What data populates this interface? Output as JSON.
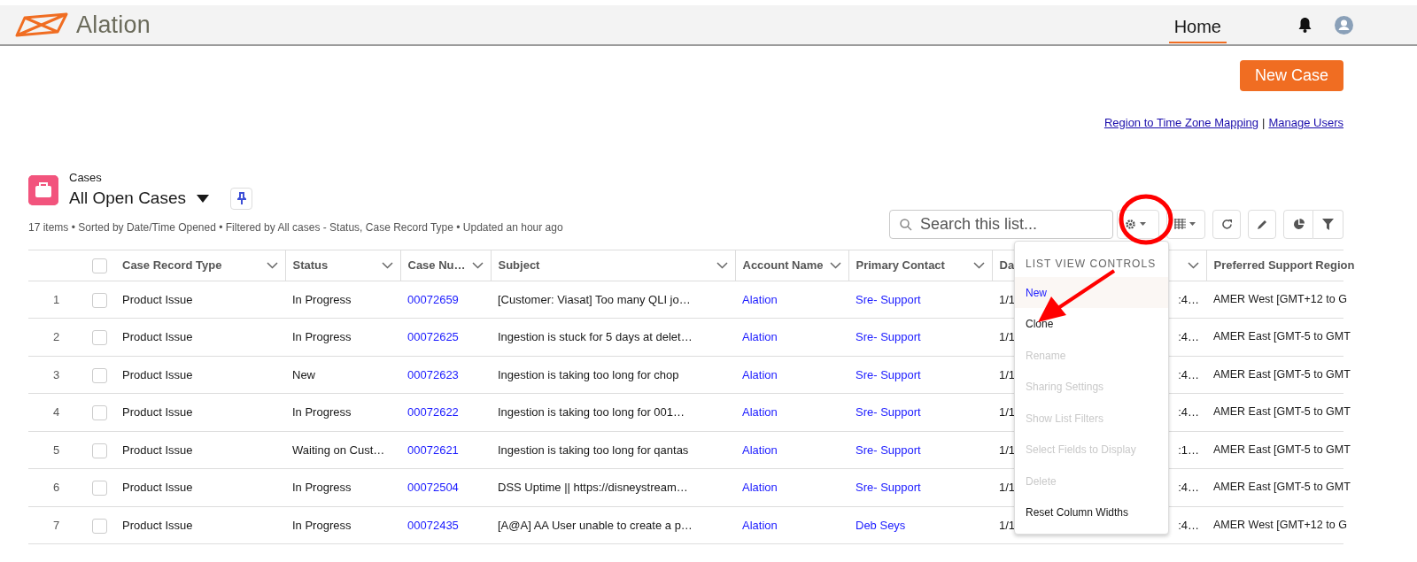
{
  "nav": {
    "logo_text": "Alation",
    "tabs": [
      {
        "label": "Home",
        "selected": true
      }
    ]
  },
  "new_case_button": "New Case",
  "links": [
    {
      "text": "Region to Time Zone Mapping"
    },
    {
      "text": "Manage Users"
    }
  ],
  "link_separator": "|",
  "list_header": {
    "object": "Cases",
    "title": "All Open Cases",
    "pinned": true
  },
  "summary": "17 items • Sorted by Date/Time Opened • Filtered by All cases - Status, Case Record Type • Updated an hour ago",
  "search": {
    "placeholder": "Search this list..."
  },
  "table": {
    "select_all_checked": false,
    "columns": [
      {
        "label": "Case Record Type",
        "sortable": true
      },
      {
        "label": "Status",
        "sortable": true
      },
      {
        "label": "Case Nu…",
        "sortable": true
      },
      {
        "label": "Subject",
        "sortable": true
      },
      {
        "label": "Account Name",
        "sortable": true
      },
      {
        "label": "Primary Contact",
        "sortable": true
      },
      {
        "label": "Da",
        "sortable": true
      },
      {
        "label": "Preferred Support Region"
      }
    ],
    "rows": [
      {
        "number": "1",
        "checked": false,
        "record_type": "Product Issue",
        "status": "In Progress",
        "case_number": "00072659",
        "subject": "[Customer: Viasat] Too many QLI jo…",
        "account": "Alation",
        "contact": "Sre- Support",
        "date_start": "1/1",
        "date_end": ":4…",
        "region": "AMER West [GMT+12 to G"
      },
      {
        "number": "2",
        "checked": false,
        "record_type": "Product Issue",
        "status": "In Progress",
        "case_number": "00072625",
        "subject": "Ingestion is stuck for 5 days at delet…",
        "account": "Alation",
        "contact": "Sre- Support",
        "date_start": "1/1",
        "date_end": ":4…",
        "region": "AMER East [GMT-5 to GMT"
      },
      {
        "number": "3",
        "checked": false,
        "record_type": "Product Issue",
        "status": "New",
        "case_number": "00072623",
        "subject": "Ingestion is taking too long for chop",
        "account": "Alation",
        "contact": "Sre- Support",
        "date_start": "1/1",
        "date_end": ":4…",
        "region": "AMER East [GMT-5 to GMT"
      },
      {
        "number": "4",
        "checked": false,
        "record_type": "Product Issue",
        "status": "In Progress",
        "case_number": "00072622",
        "subject": "Ingestion is taking too long for 001…",
        "account": "Alation",
        "contact": "Sre- Support",
        "date_start": "1/1",
        "date_end": ":4…",
        "region": "AMER East [GMT-5 to GMT"
      },
      {
        "number": "5",
        "checked": false,
        "record_type": "Product Issue",
        "status": "Waiting on Cust…",
        "case_number": "00072621",
        "subject": "Ingestion is taking too long for qantas",
        "account": "Alation",
        "contact": "Sre- Support",
        "date_start": "1/1",
        "date_end": ":1…",
        "region": "AMER East [GMT-5 to GMT"
      },
      {
        "number": "6",
        "checked": false,
        "record_type": "Product Issue",
        "status": "In Progress",
        "case_number": "00072504",
        "subject": "DSS Uptime || https://disneystream…",
        "account": "Alation",
        "contact": "Sre- Support",
        "date_start": "1/1",
        "date_end": ":4…",
        "region": "AMER East [GMT-5 to GMT"
      },
      {
        "number": "7",
        "checked": false,
        "record_type": "Product Issue",
        "status": "In Progress",
        "case_number": "00072435",
        "subject": "[A@A] AA User unable to create a p…",
        "account": "Alation",
        "contact": "Deb Seys",
        "date_start": "1/1",
        "date_end": ":4…",
        "region": "AMER West [GMT+12 to G"
      }
    ]
  },
  "menu": {
    "title": "LIST VIEW CONTROLS",
    "items": [
      {
        "label": "New",
        "disabled": false,
        "highlighted": true
      },
      {
        "label": "Clone",
        "disabled": false,
        "highlighted": false
      },
      {
        "label": "Rename",
        "disabled": true,
        "highlighted": false
      },
      {
        "label": "Sharing Settings",
        "disabled": true,
        "highlighted": false
      },
      {
        "label": "Show List Filters",
        "disabled": true,
        "highlighted": false
      },
      {
        "label": "Select Fields to Display",
        "disabled": true,
        "highlighted": false
      },
      {
        "label": "Delete",
        "disabled": true,
        "highlighted": false
      },
      {
        "label": "Reset Column Widths",
        "disabled": false,
        "highlighted": false
      }
    ]
  }
}
